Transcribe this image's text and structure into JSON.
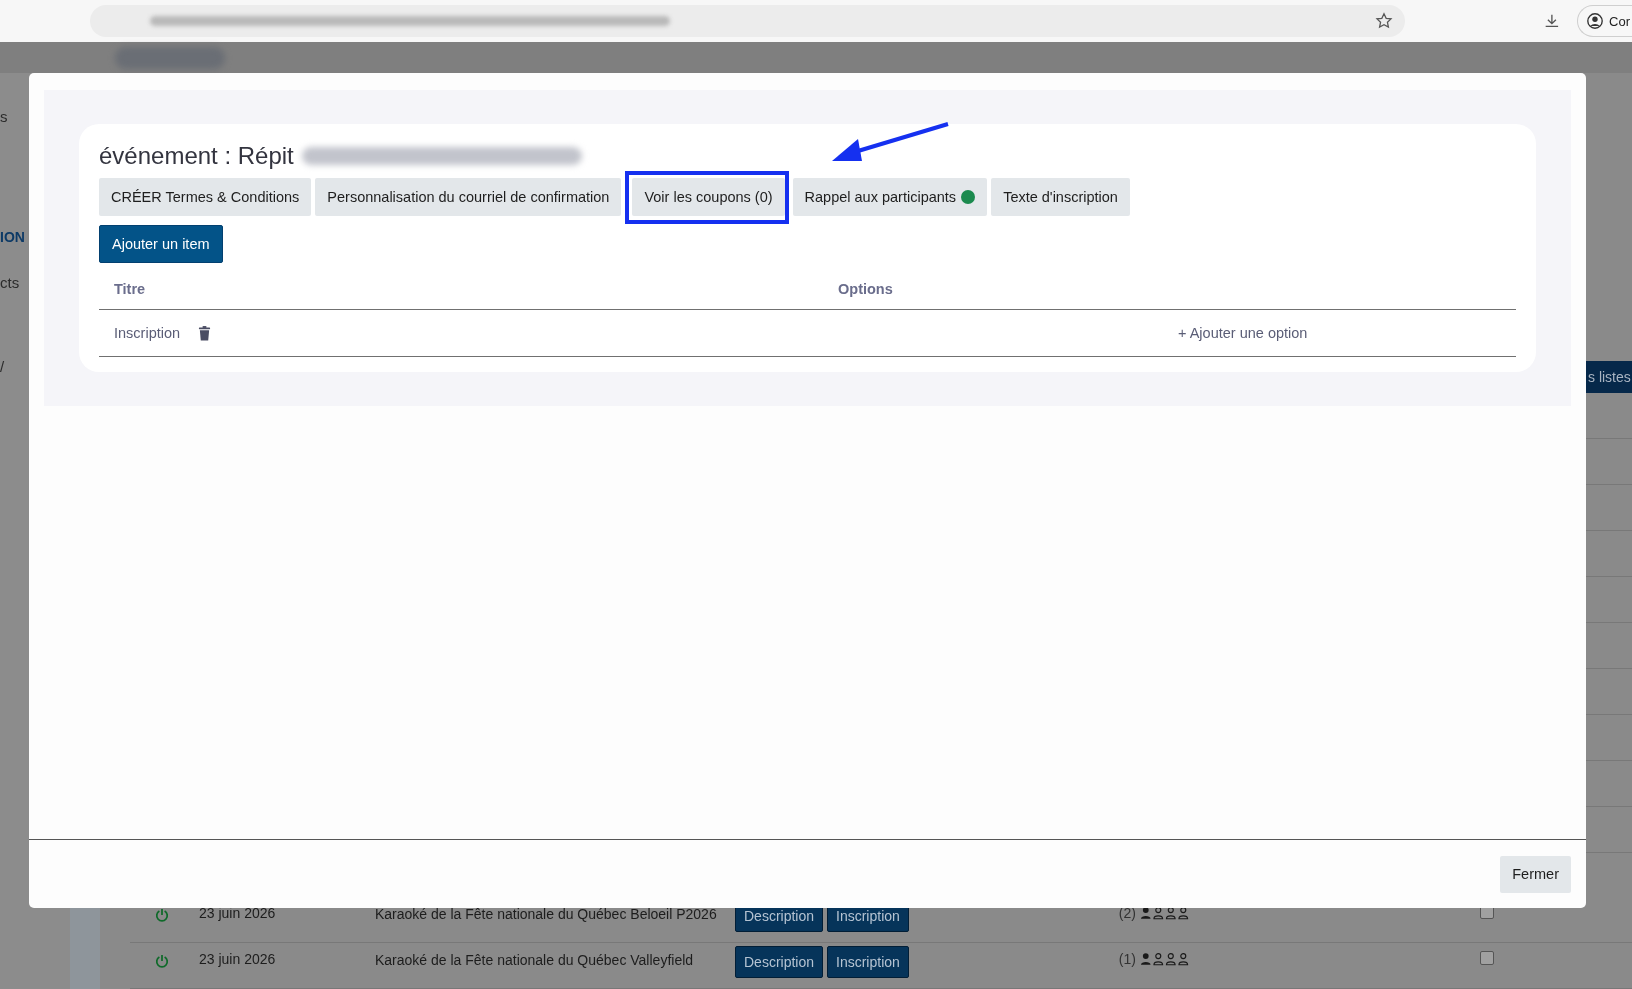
{
  "browser": {
    "profile_label": "Cor"
  },
  "sidebar": {
    "items": [
      {
        "label": "s",
        "active": false
      },
      {
        "label": "ION",
        "active": true
      },
      {
        "label": "cts",
        "active": false
      },
      {
        "label": "/",
        "active": false
      }
    ]
  },
  "background_table": {
    "side_tab": "s listes",
    "rows": [
      {
        "date": "23 juin 2026",
        "title": "Karaoké de la Fête nationale du Québec Beloeil P2026",
        "buttons": [
          "Description",
          "Inscription"
        ],
        "count": "(2)",
        "checked": false
      },
      {
        "date": "23 juin 2026",
        "title": "Karaoké de la Fête nationale du Québec Valleyfield",
        "buttons": [
          "Description",
          "Inscription"
        ],
        "count": "(1)",
        "checked": false
      }
    ]
  },
  "modal": {
    "title": "événement : Répit",
    "tabs": [
      {
        "label": "CRÉER Termes & Conditions",
        "indicator": false,
        "highlighted": false
      },
      {
        "label": "Personnalisation du courriel de confirmation",
        "indicator": false,
        "highlighted": false
      },
      {
        "label": "Voir les coupons (0)",
        "indicator": false,
        "highlighted": true
      },
      {
        "label": "Rappel aux participants",
        "indicator": true,
        "highlighted": false
      },
      {
        "label": "Texte d'inscription",
        "indicator": false,
        "highlighted": false
      }
    ],
    "add_button": "Ajouter un item",
    "table": {
      "columns": [
        "Titre",
        "Options"
      ],
      "rows": [
        {
          "title": "Inscription",
          "action": "+ Ajouter une option"
        }
      ]
    },
    "close_button": "Fermer"
  }
}
